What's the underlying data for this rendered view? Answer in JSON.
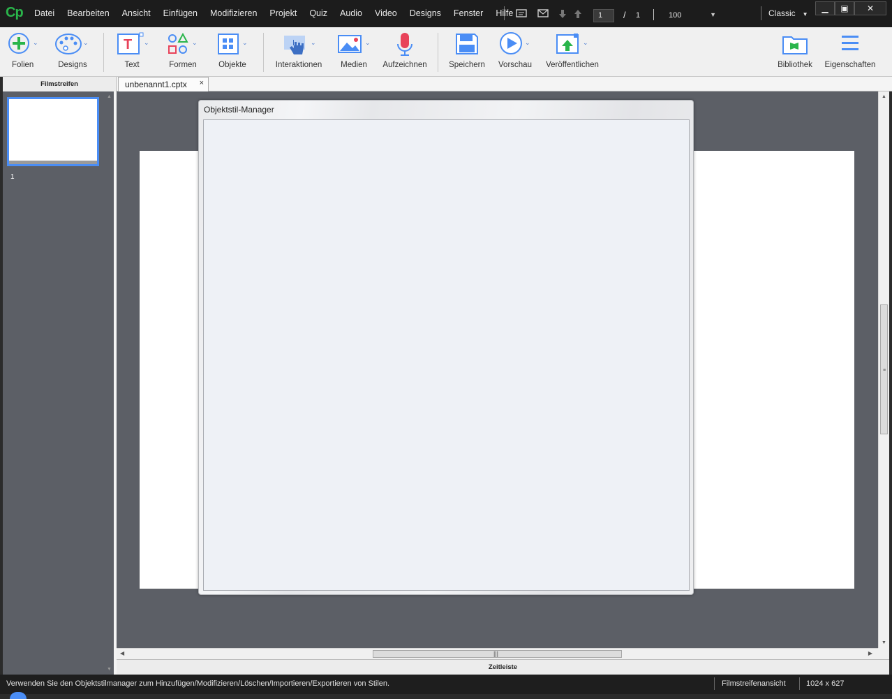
{
  "app": {
    "logo": "Cp",
    "menu": [
      "Datei",
      "Bearbeiten",
      "Ansicht",
      "Einfügen",
      "Modifizieren",
      "Projekt",
      "Quiz",
      "Audio",
      "Video",
      "Designs",
      "Fenster",
      "Hilfe"
    ],
    "slide_current": "1",
    "slide_divider": "/",
    "slide_total": "1",
    "zoom": "100",
    "workspace": "Classic",
    "window_controls": {
      "minimize": "▁",
      "maximize": "▣",
      "close": "✕"
    }
  },
  "ribbon": {
    "buttons": [
      {
        "label": "Folien",
        "icon": "add-slide-icon"
      },
      {
        "label": "Designs",
        "icon": "palette-icon"
      },
      {
        "label": "Text",
        "icon": "text-icon"
      },
      {
        "label": "Formen",
        "icon": "shapes-icon"
      },
      {
        "label": "Objekte",
        "icon": "objects-icon"
      },
      {
        "label": "Interaktionen",
        "icon": "hand-pointer-icon"
      },
      {
        "label": "Medien",
        "icon": "image-icon"
      },
      {
        "label": "Aufzeichnen",
        "icon": "microphone-icon"
      },
      {
        "label": "Speichern",
        "icon": "save-icon"
      },
      {
        "label": "Vorschau",
        "icon": "play-icon"
      },
      {
        "label": "Veröffentlichen",
        "icon": "publish-icon"
      },
      {
        "label": "Bibliothek",
        "icon": "library-icon"
      },
      {
        "label": "Eigenschaften",
        "icon": "properties-icon"
      }
    ]
  },
  "filmstrip": {
    "title": "Filmstreifen",
    "slide_number": "1"
  },
  "document": {
    "tab_label": "unbenannt1.cptx",
    "close": "×"
  },
  "timeline": {
    "title": "Zeitleiste"
  },
  "dialog": {
    "title": "Objektstil-Manager"
  },
  "statusbar": {
    "message": "Verwenden Sie den Objektstilmanager zum Hinzufügen/Modifizieren/Löschen/Importieren/Exportieren von Stilen.",
    "view": "Filmstreifenansicht",
    "dimensions": "1024 x 627"
  },
  "colors": {
    "accent": "#4a8df5",
    "logo": "#2ab54b",
    "stage": "#5c5f66",
    "record": "#e8435a"
  }
}
